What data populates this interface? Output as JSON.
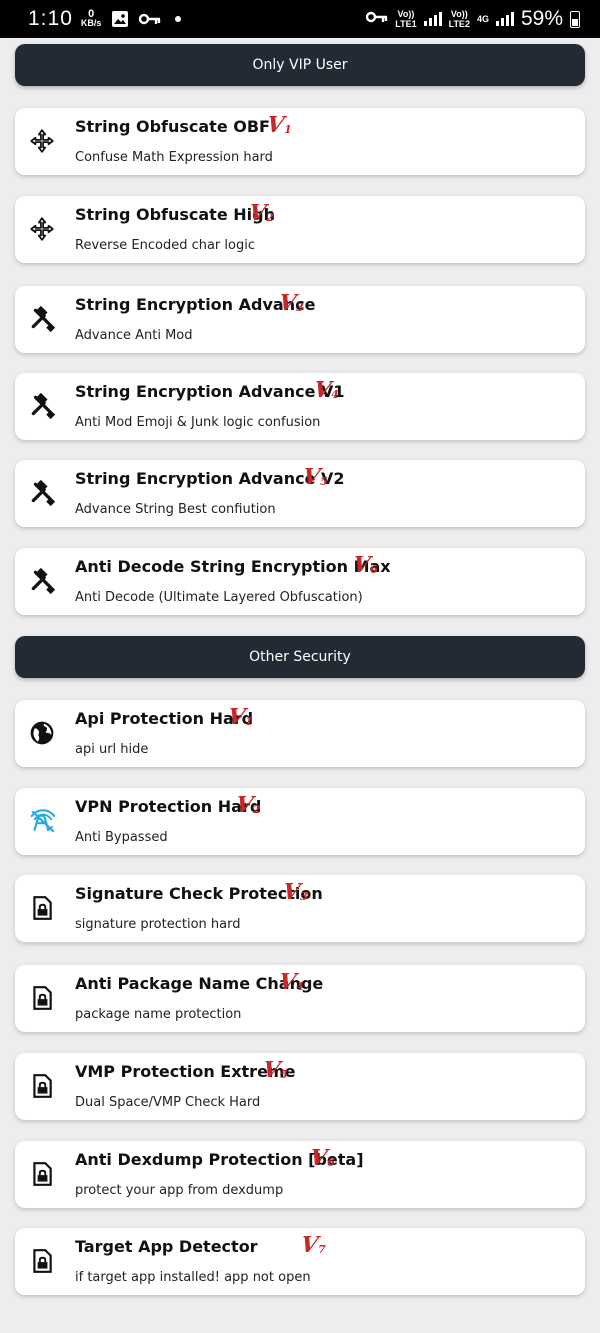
{
  "status_bar": {
    "time": "1:10",
    "speed_value": "0",
    "speed_unit": "KB/s",
    "sim1_top": "Vo))",
    "sim1_bottom": "LTE1",
    "sim2_top": "Vo))",
    "sim2_bottom": "LTE2",
    "network": "4G",
    "battery": "59%"
  },
  "sections": {
    "vip": "Only VIP User",
    "other": "Other Security"
  },
  "vip_items": [
    {
      "title": "String Obfuscate OBF",
      "subtitle": "Confuse Math Expression hard",
      "badge_letter": "V",
      "badge_num": "1",
      "icon": "arrows-move-icon"
    },
    {
      "title": "String Obfuscate High",
      "subtitle": "Reverse Encoded char logic",
      "badge_letter": "V",
      "badge_num": "2",
      "icon": "arrows-move-icon"
    },
    {
      "title": "String Encryption Advance",
      "subtitle": "Advance Anti Mod",
      "badge_letter": "V",
      "badge_num": "3",
      "icon": "tools-icon"
    },
    {
      "title": "String Encryption Advance V1",
      "subtitle": "Anti Mod Emoji & Junk logic confusion",
      "badge_letter": "V",
      "badge_num": "4",
      "icon": "tools-icon"
    },
    {
      "title": "String Encryption Advance V2",
      "subtitle": "Advance String Best confiution",
      "badge_letter": "V",
      "badge_num": "5",
      "icon": "tools-icon"
    },
    {
      "title": "Anti Decode String Encryption Max",
      "subtitle": "Anti Decode (Ultimate Layered Obfuscation)",
      "badge_letter": "V",
      "badge_num": "6",
      "icon": "tools-icon"
    }
  ],
  "other_items": [
    {
      "title": "Api Protection Hard",
      "subtitle": "api url hide",
      "badge_letter": "V",
      "badge_num": "1",
      "icon": "globe-icon"
    },
    {
      "title": "VPN Protection Hard",
      "subtitle": "Anti Bypassed",
      "badge_letter": "V",
      "badge_num": "2",
      "icon": "vpn-off-icon"
    },
    {
      "title": "Signature Check Protection",
      "subtitle": "signature protection hard",
      "badge_letter": "V",
      "badge_num": "3",
      "icon": "file-lock-icon"
    },
    {
      "title": "Anti Package Name Change",
      "subtitle": "package name protection",
      "badge_letter": "V",
      "badge_num": "4",
      "icon": "file-lock-icon"
    },
    {
      "title": "VMP Protection Extreme",
      "subtitle": "Dual Space/VMP Check Hard",
      "badge_letter": "V",
      "badge_num": "5",
      "icon": "file-lock-icon"
    },
    {
      "title": "Anti Dexdump Protection [beta]",
      "subtitle": "protect your app from dexdump",
      "badge_letter": "V",
      "badge_num": "6",
      "icon": "file-lock-icon"
    },
    {
      "title": "Target App Detector",
      "subtitle": "if target app installed! app not open",
      "badge_letter": "V",
      "badge_num": "7",
      "icon": "file-lock-icon"
    }
  ],
  "colors": {
    "section_bg": "#222b34",
    "badge": "#c62828",
    "vpn_icon": "#29a8e0"
  }
}
